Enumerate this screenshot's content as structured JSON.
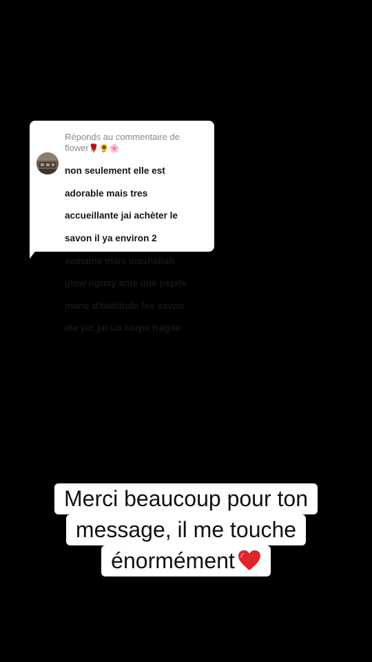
{
  "reply": {
    "header_text": "Réponds au commentaire de flower",
    "header_emojis": "🌹🌻🌸",
    "comment_lines": [
      "non seulement elle est",
      "adorable mais tres",
      "accueillante jai achèter le",
      "savon il ya environ 2",
      "semaine mais mashallah",
      "glow nguay ame une pépite",
      "mane d'habitude les savon",
      "me pic jai un corps fragile"
    ],
    "avatar_icon": "user-avatar-photo"
  },
  "caption": {
    "lines": [
      "Merci beaucoup pour ton",
      "message, il me touche",
      "énormément"
    ],
    "trailing_icon": "red-heart-icon"
  },
  "colors": {
    "background": "#000000",
    "card": "#ffffff",
    "header_text": "#8a8a8a",
    "body_text": "#161616",
    "heart": "#e0242b"
  }
}
